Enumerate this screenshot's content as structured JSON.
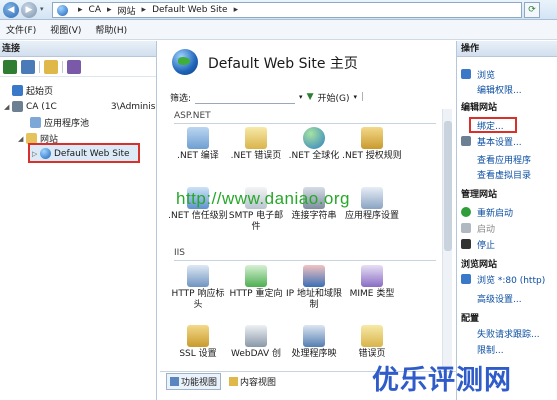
{
  "address": {
    "crumbs": [
      "CA",
      "网站",
      "Default Web Site"
    ]
  },
  "menu": {
    "file": "文件(F)",
    "view": "视图(V)",
    "help": "帮助(H)"
  },
  "connections": {
    "header": "连接",
    "tree": {
      "start_page": "起始页",
      "server": "CA (1C      3\\Adminis",
      "app_pools": "应用程序池",
      "sites": "网站",
      "default_site": "Default Web Site"
    }
  },
  "center": {
    "title": "Default Web Site 主页",
    "filter_label": "筛选:",
    "start_label": "开始(G)",
    "sections": {
      "aspnet": "ASP.NET",
      "iis": "IIS"
    },
    "aspnet_items": [
      ".NET 编译",
      ".NET 错误页",
      ".NET 全球化",
      ".NET 授权规则",
      ".NET 信任级别",
      "SMTP 电子邮件",
      "连接字符串",
      "应用程序设置"
    ],
    "iis_items": [
      "HTTP 响应标头",
      "HTTP 重定向",
      "IP 地址和域限制",
      "MIME 类型",
      "SSL 设置",
      "WebDAV 创",
      "处理程序映",
      "错误页"
    ],
    "watermark": "http://www.daniao.org",
    "tabs": {
      "features": "功能视图",
      "content": "内容视图"
    }
  },
  "actions": {
    "header": "操作",
    "browse": "浏览",
    "edit_perms": "编辑权限...",
    "edit_site_title": "编辑网站",
    "bindings": "绑定...",
    "basic_settings": "基本设置...",
    "view_apps": "查看应用程序",
    "view_vdirs": "查看虚拟目录",
    "manage_site_title": "管理网站",
    "restart": "重新启动",
    "start": "启动",
    "stop": "停止",
    "browse_site_title": "浏览网站",
    "browse_80": "浏览 *:80 (http)",
    "advanced": "高级设置...",
    "config_title": "配置",
    "failed_trace": "失败请求跟踪...",
    "limits": "限制..."
  },
  "brand": "优乐评测网"
}
